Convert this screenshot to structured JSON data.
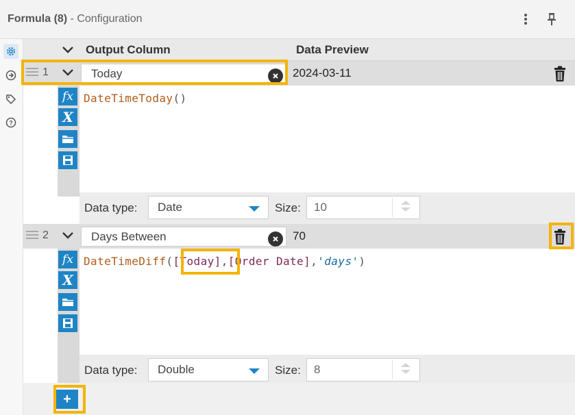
{
  "header": {
    "title": "Formula (8)",
    "subtitle": "- Configuration"
  },
  "columns": {
    "output_column": "Output Column",
    "data_preview": "Data Preview"
  },
  "rows": [
    {
      "number": "1",
      "name": "Today",
      "preview": "2024-03-11",
      "expression": {
        "fn": "DateTimeToday",
        "open": "(",
        "close": ")"
      },
      "data_type_label": "Data type:",
      "data_type": "Date",
      "size_label": "Size:",
      "size": "10"
    },
    {
      "number": "2",
      "name": "Days Between",
      "preview": "70",
      "expression": {
        "fn": "DateTimeDiff",
        "open": "(",
        "arg1": "[Today]",
        "comma1": ",",
        "arg2": "[Order Date]",
        "comma2": ",",
        "arg3": "'days'",
        "close": ")"
      },
      "data_type_label": "Data type:",
      "data_type": "Double",
      "size_label": "Size:",
      "size": "8"
    }
  ],
  "tool_icons": [
    "fx-icon",
    "variable-icon",
    "open-folder-icon",
    "save-icon"
  ],
  "glyphs": {
    "fx": "fx",
    "x": "X",
    "add": "+"
  },
  "colors": {
    "accent": "#1f84c6",
    "highlight": "#f4b400"
  }
}
